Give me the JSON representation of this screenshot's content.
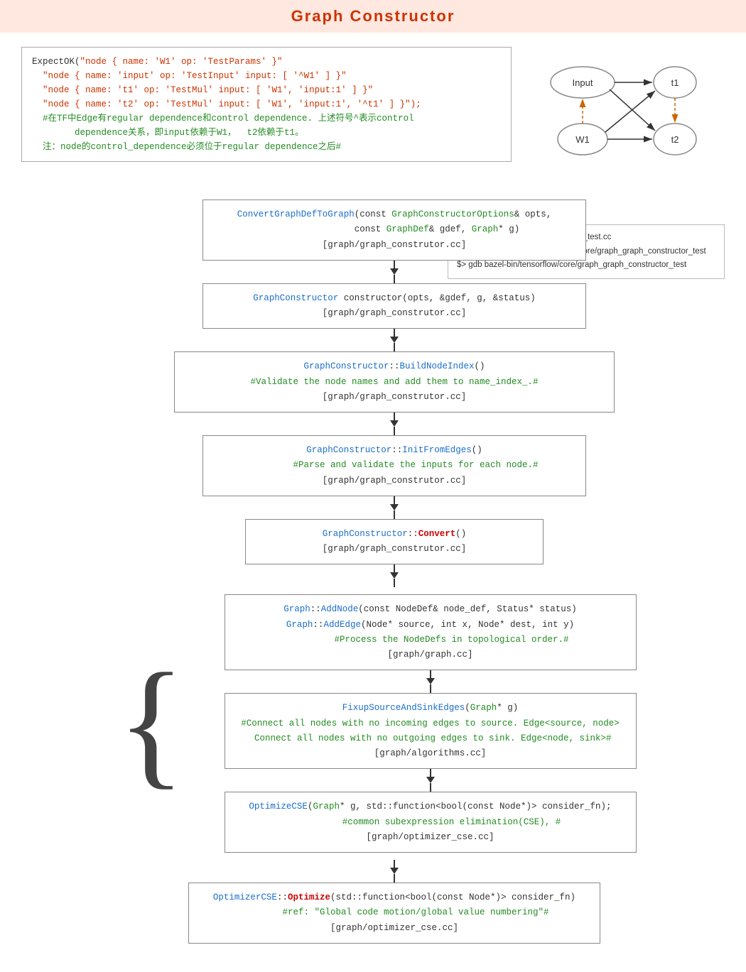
{
  "title": "Graph  Constructor",
  "topCode": {
    "lines": [
      {
        "parts": [
          {
            "text": "ExpectOK(\"node { name: 'W1' op: 'TestParams' }\"",
            "color": "default"
          }
        ]
      },
      {
        "parts": [
          {
            "text": "  \"node { name: 'input' op: 'TestInput' input: [ '^W1' ] }\"",
            "color": "red"
          }
        ]
      },
      {
        "parts": [
          {
            "text": "  \"node { name: 't1' op: 'TestMul' input: [ 'W1', 'input:1' ] }\"",
            "color": "red"
          }
        ]
      },
      {
        "parts": [
          {
            "text": "  \"node { name: 't2' op: 'TestMul' input: [ 'W1', 'input:1', '^t1' ] }\");",
            "color": "red"
          }
        ]
      },
      {
        "parts": [
          {
            "text": "  #在TF中Edge有regular dependence和control dependence. 上述符号^表示control",
            "color": "green"
          }
        ]
      },
      {
        "parts": [
          {
            "text": "        dependence关系，即input依赖于W1，  t2依赖于t1。",
            "color": "green"
          }
        ]
      },
      {
        "parts": [
          {
            "text": "  注：node的control_dependence必须位于regular dependence之后#",
            "color": "green"
          }
        ]
      }
    ]
  },
  "annotation": {
    "lines": [
      "调试文件: graph/graph_constructor_test.cc",
      "$> bazel build -c dbg //tensorflow/core/graph_graph_constructor_test",
      "$> gdb bazel-bin/tensorflow/core/graph_graph_constructor_test"
    ]
  },
  "boxes": [
    {
      "id": "box1",
      "lines": [
        {
          "text": "ConvertGraphDefToGraph(const ",
          "spans": [
            {
              "text": "GraphConstructorOptions",
              "color": "green"
            },
            {
              "text": "& opts,",
              "color": "default"
            }
          ]
        },
        {
          "text": "                const ",
          "spans": [
            {
              "text": "GraphDef",
              "color": "green"
            },
            {
              "text": "& gdef, ",
              "color": "default"
            },
            {
              "text": "Graph",
              "color": "green"
            },
            {
              "text": "* g)",
              "color": "default"
            }
          ]
        },
        {
          "text": "[graph/graph_construtor.cc]",
          "color": "default",
          "center": true
        }
      ],
      "raw": "ConvertGraphDefToGraph(const GraphConstructorOptions& opts,\n                const GraphDef& gdef, Graph* g)\n[graph/graph_construtor.cc]"
    },
    {
      "id": "box2",
      "raw": "GraphConstructor constructor(opts, &gdef, g, &status)\n                [graph/graph_construtor.cc]"
    },
    {
      "id": "box3",
      "raw": "GraphConstructor::BuildNodeIndex()\n#Validate the node names and add them to name_index_.#\n                [graph/graph_construtor.cc]"
    },
    {
      "id": "box4",
      "raw": "GraphConstructor::InitFromEdges()\n        #Parse and validate the inputs for each node.#\n                [graph/graph_construtor.cc]"
    },
    {
      "id": "box5",
      "raw": "GraphConstructor::Convert()\n        [graph/graph_construtor.cc]"
    }
  ],
  "groupedBoxes": [
    {
      "id": "gbox1",
      "raw": "Graph::AddNode(const NodeDef& node_def, Status* status)\nGraph::AddEdge(Node* source, int x, Node* dest, int y)\n        #Process the NodeDefs in topological order.#\n                [graph/graph.cc]"
    },
    {
      "id": "gbox2",
      "raw": "FixupSourceAndSinkEdges(Graph* g)\n#Connect all nodes with no incoming edges to source. Edge<source, node>\n Connect all nodes with no outgoing edges to sink. Edge<node, sink>#\n                [graph/algorithms.cc]"
    },
    {
      "id": "gbox3",
      "raw": "OptimizeCSE(Graph* g, std::function<bool(const Node*)> consider_fn);\n        #common subexpression elimination(CSE), #\n                [graph/optimizer_cse.cc]"
    }
  ],
  "finalBox": {
    "raw": "OptimizerCSE::Optimize(std::function<bool(const Node*)> consider_fn)\n        #ref: \"Global code motion/global value numbering\"#\n                [graph/optimizer_cse.cc]"
  }
}
